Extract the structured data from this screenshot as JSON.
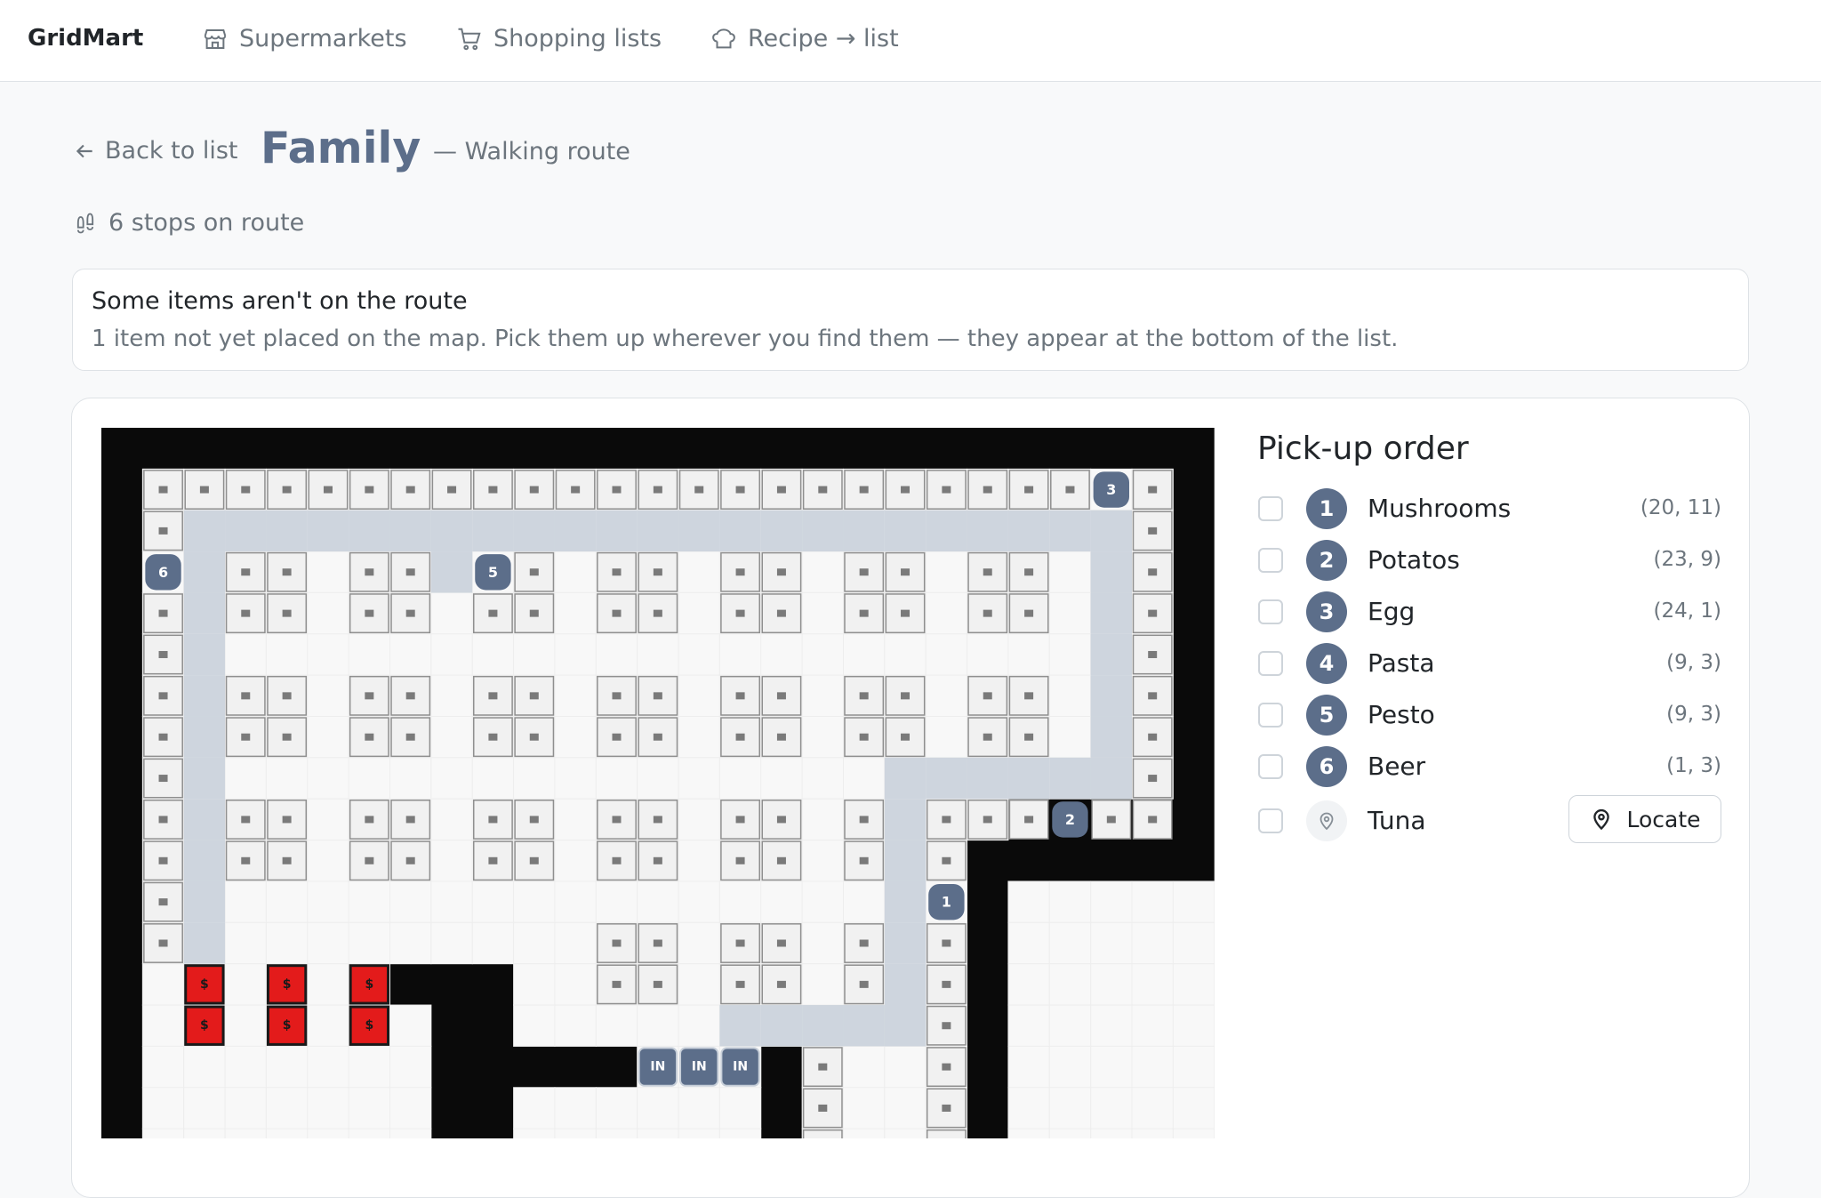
{
  "nav": {
    "brand": "GridMart",
    "links": [
      {
        "label": "Supermarkets",
        "icon": "shop-icon"
      },
      {
        "label": "Shopping lists",
        "icon": "cart-icon"
      },
      {
        "label": "Recipe → list",
        "icon": "chef-hat-icon"
      }
    ]
  },
  "header": {
    "back_label": "Back to list",
    "title": "Family",
    "subtitle": "— Walking route",
    "stops_text": "6 stops on route"
  },
  "alert": {
    "title": "Some items aren't on the route",
    "text": "1 item not yet placed on the map. Pick them up wherever you find them — they appear at the bottom of the list."
  },
  "pickup": {
    "title": "Pick-up order",
    "items": [
      {
        "num": "1",
        "name": "Mushrooms",
        "coord": "(20, 11)"
      },
      {
        "num": "2",
        "name": "Potatos",
        "coord": "(23, 9)"
      },
      {
        "num": "3",
        "name": "Egg",
        "coord": "(24, 1)"
      },
      {
        "num": "4",
        "name": "Pasta",
        "coord": "(9, 3)"
      },
      {
        "num": "5",
        "name": "Pesto",
        "coord": "(9, 3)"
      },
      {
        "num": "6",
        "name": "Beer",
        "coord": "(1, 3)"
      }
    ],
    "unplaced": {
      "name": "Tuna",
      "locate_label": "Locate"
    }
  },
  "map": {
    "grid_cols": 27,
    "grid_rows": 18,
    "colors": {
      "wall": "#0a0a0a",
      "floor": "#f8f8f8",
      "shelf": "#f1f1f1",
      "route": "#ced5de",
      "stop": "#5c6e8a",
      "checkout": "#e31b1b"
    },
    "shelf_cells": [
      [
        1,
        1
      ],
      [
        2,
        1
      ],
      [
        3,
        1
      ],
      [
        4,
        1
      ],
      [
        5,
        1
      ],
      [
        6,
        1
      ],
      [
        7,
        1
      ],
      [
        8,
        1
      ],
      [
        9,
        1
      ],
      [
        10,
        1
      ],
      [
        11,
        1
      ],
      [
        12,
        1
      ],
      [
        13,
        1
      ],
      [
        14,
        1
      ],
      [
        15,
        1
      ],
      [
        16,
        1
      ],
      [
        17,
        1
      ],
      [
        18,
        1
      ],
      [
        19,
        1
      ],
      [
        20,
        1
      ],
      [
        21,
        1
      ],
      [
        22,
        1
      ],
      [
        23,
        1
      ],
      [
        25,
        1
      ],
      [
        1,
        2
      ],
      [
        25,
        2
      ],
      [
        25,
        3
      ],
      [
        1,
        4
      ],
      [
        25,
        4
      ],
      [
        1,
        5
      ],
      [
        25,
        5
      ],
      [
        1,
        6
      ],
      [
        25,
        6
      ],
      [
        1,
        7
      ],
      [
        25,
        7
      ],
      [
        1,
        8
      ],
      [
        25,
        8
      ],
      [
        1,
        9
      ],
      [
        1,
        10
      ],
      [
        1,
        11
      ],
      [
        1,
        12
      ],
      [
        3,
        3
      ],
      [
        4,
        3
      ],
      [
        6,
        3
      ],
      [
        7,
        3
      ],
      [
        10,
        3
      ],
      [
        12,
        3
      ],
      [
        13,
        3
      ],
      [
        15,
        3
      ],
      [
        16,
        3
      ],
      [
        18,
        3
      ],
      [
        19,
        3
      ],
      [
        21,
        3
      ],
      [
        22,
        3
      ],
      [
        3,
        4
      ],
      [
        4,
        4
      ],
      [
        6,
        4
      ],
      [
        7,
        4
      ],
      [
        9,
        4
      ],
      [
        10,
        4
      ],
      [
        12,
        4
      ],
      [
        13,
        4
      ],
      [
        15,
        4
      ],
      [
        16,
        4
      ],
      [
        18,
        4
      ],
      [
        19,
        4
      ],
      [
        21,
        4
      ],
      [
        22,
        4
      ],
      [
        3,
        6
      ],
      [
        4,
        6
      ],
      [
        6,
        6
      ],
      [
        7,
        6
      ],
      [
        9,
        6
      ],
      [
        10,
        6
      ],
      [
        12,
        6
      ],
      [
        13,
        6
      ],
      [
        15,
        6
      ],
      [
        16,
        6
      ],
      [
        18,
        6
      ],
      [
        19,
        6
      ],
      [
        21,
        6
      ],
      [
        22,
        6
      ],
      [
        3,
        7
      ],
      [
        4,
        7
      ],
      [
        6,
        7
      ],
      [
        7,
        7
      ],
      [
        9,
        7
      ],
      [
        10,
        7
      ],
      [
        12,
        7
      ],
      [
        13,
        7
      ],
      [
        15,
        7
      ],
      [
        16,
        7
      ],
      [
        18,
        7
      ],
      [
        19,
        7
      ],
      [
        21,
        7
      ],
      [
        22,
        7
      ],
      [
        3,
        9
      ],
      [
        4,
        9
      ],
      [
        6,
        9
      ],
      [
        7,
        9
      ],
      [
        9,
        9
      ],
      [
        10,
        9
      ],
      [
        12,
        9
      ],
      [
        13,
        9
      ],
      [
        15,
        9
      ],
      [
        16,
        9
      ],
      [
        18,
        9
      ],
      [
        20,
        9
      ],
      [
        21,
        9
      ],
      [
        22,
        9
      ],
      [
        24,
        9
      ],
      [
        25,
        9
      ],
      [
        3,
        10
      ],
      [
        4,
        10
      ],
      [
        6,
        10
      ],
      [
        7,
        10
      ],
      [
        9,
        10
      ],
      [
        10,
        10
      ],
      [
        12,
        10
      ],
      [
        13,
        10
      ],
      [
        15,
        10
      ],
      [
        16,
        10
      ],
      [
        18,
        10
      ],
      [
        20,
        10
      ],
      [
        12,
        12
      ],
      [
        13,
        12
      ],
      [
        15,
        12
      ],
      [
        16,
        12
      ],
      [
        18,
        12
      ],
      [
        20,
        12
      ],
      [
        12,
        13
      ],
      [
        13,
        13
      ],
      [
        15,
        13
      ],
      [
        16,
        13
      ],
      [
        18,
        13
      ],
      [
        20,
        13
      ],
      [
        20,
        14
      ],
      [
        17,
        15
      ],
      [
        20,
        15
      ],
      [
        17,
        16
      ],
      [
        20,
        16
      ],
      [
        17,
        17
      ],
      [
        20,
        17
      ]
    ],
    "stops": [
      {
        "label": "1",
        "cell": [
          20,
          11
        ]
      },
      {
        "label": "2",
        "cell": [
          23,
          9
        ]
      },
      {
        "label": "3",
        "cell": [
          24,
          1
        ]
      },
      {
        "label": "5",
        "cell": [
          9,
          3
        ]
      },
      {
        "label": "6",
        "cell": [
          1,
          3
        ]
      }
    ],
    "checkouts": [
      [
        2,
        13
      ],
      [
        4,
        13
      ],
      [
        6,
        13
      ],
      [
        2,
        14
      ],
      [
        4,
        14
      ],
      [
        6,
        14
      ]
    ],
    "checkout_symbol": "$",
    "entrances": [
      [
        13,
        15
      ],
      [
        14,
        15
      ],
      [
        15,
        15
      ]
    ],
    "entrance_label": "IN"
  }
}
